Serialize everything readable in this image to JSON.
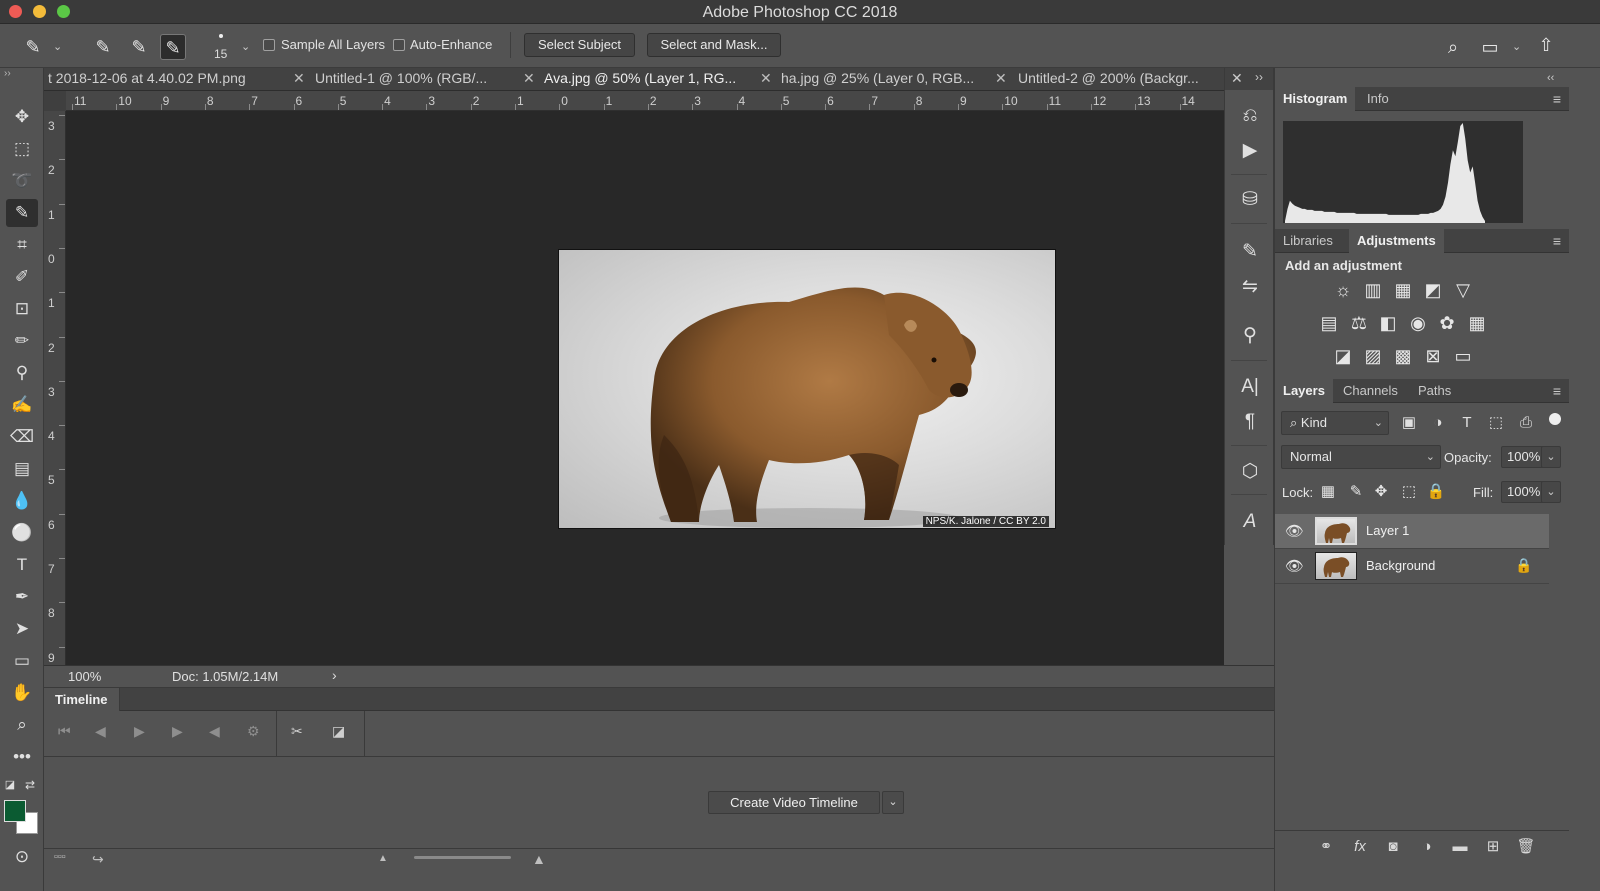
{
  "window": {
    "title": "Adobe Photoshop CC 2018"
  },
  "options_bar": {
    "brush_size": "15",
    "sample_all_layers_label": "Sample All Layers",
    "auto_enhance_label": "Auto-Enhance",
    "select_subject_label": "Select Subject",
    "select_and_mask_label": "Select and Mask..."
  },
  "document_tabs": [
    {
      "label": "t 2018-12-06 at 4.40.02 PM.png",
      "active": false
    },
    {
      "label": "Untitled-1 @ 100% (RGB/...",
      "active": false
    },
    {
      "label": "Ava.jpg @ 50% (Layer 1, RG...",
      "active": true
    },
    {
      "label": "ha.jpg @ 25% (Layer 0, RGB...",
      "active": false
    },
    {
      "label": "Untitled-2 @ 200% (Backgr...",
      "active": false
    }
  ],
  "rulers": {
    "top": [
      "11",
      "10",
      "9",
      "8",
      "7",
      "6",
      "5",
      "4",
      "3",
      "2",
      "1",
      "0",
      "1",
      "2",
      "3",
      "4",
      "5",
      "6",
      "7",
      "8",
      "9",
      "10",
      "11",
      "12",
      "13",
      "14"
    ],
    "left": [
      "3",
      "2",
      "1",
      "0",
      "1",
      "2",
      "3",
      "4",
      "5",
      "6",
      "7",
      "8",
      "9"
    ]
  },
  "canvas": {
    "image_credit": "NPS/K. Jalone / CC BY 2.0"
  },
  "status_bar": {
    "zoom": "100%",
    "doc_size": "Doc: 1.05M/2.14M"
  },
  "timeline": {
    "tab_label": "Timeline",
    "create_button_label": "Create Video Timeline"
  },
  "histogram_panel": {
    "tabs": [
      "Histogram",
      "Info"
    ],
    "active_tab": "Histogram",
    "bins": [
      2,
      14,
      22,
      19,
      17,
      16,
      15,
      14,
      14,
      13,
      13,
      13,
      12,
      12,
      12,
      12,
      11,
      11,
      11,
      11,
      11,
      10,
      10,
      10,
      10,
      10,
      10,
      10,
      10,
      9,
      9,
      9,
      9,
      9,
      9,
      9,
      9,
      9,
      9,
      9,
      9,
      9,
      8,
      8,
      8,
      8,
      8,
      8,
      8,
      8,
      8,
      8,
      8,
      8,
      8,
      9,
      9,
      9,
      9,
      10,
      10,
      11,
      12,
      14,
      18,
      26,
      40,
      58,
      72,
      66,
      80,
      96,
      99,
      84,
      62,
      50,
      56,
      40,
      22,
      12,
      6,
      2
    ]
  },
  "adjustments_panel": {
    "tabs": [
      "Libraries",
      "Adjustments"
    ],
    "active_tab": "Adjustments",
    "heading": "Add an adjustment",
    "icons": [
      "brightness-icon",
      "levels-icon",
      "curves-icon",
      "exposure-icon",
      "vibrance-icon",
      "hue-saturation-icon",
      "color-balance-icon",
      "black-white-icon",
      "photo-filter-icon",
      "channel-mixer-icon",
      "color-lookup-icon",
      "invert-icon",
      "posterize-icon",
      "threshold-icon",
      "selective-color-icon",
      "gradient-map-icon"
    ]
  },
  "layers_panel": {
    "tabs": [
      "Layers",
      "Channels",
      "Paths"
    ],
    "active_tab": "Layers",
    "filter_kind": "Kind",
    "blend_mode": "Normal",
    "opacity_label": "Opacity:",
    "opacity_value": "100%",
    "lock_label": "Lock:",
    "fill_label": "Fill:",
    "fill_value": "100%",
    "layers": [
      {
        "name": "Layer 1",
        "selected": true,
        "locked": false
      },
      {
        "name": "Background",
        "selected": false,
        "locked": true
      }
    ]
  },
  "colors": {
    "foreground": "#0b5b32",
    "background": "#ffffff",
    "canvas_bg": "#282828",
    "panel_bg": "#535353"
  }
}
